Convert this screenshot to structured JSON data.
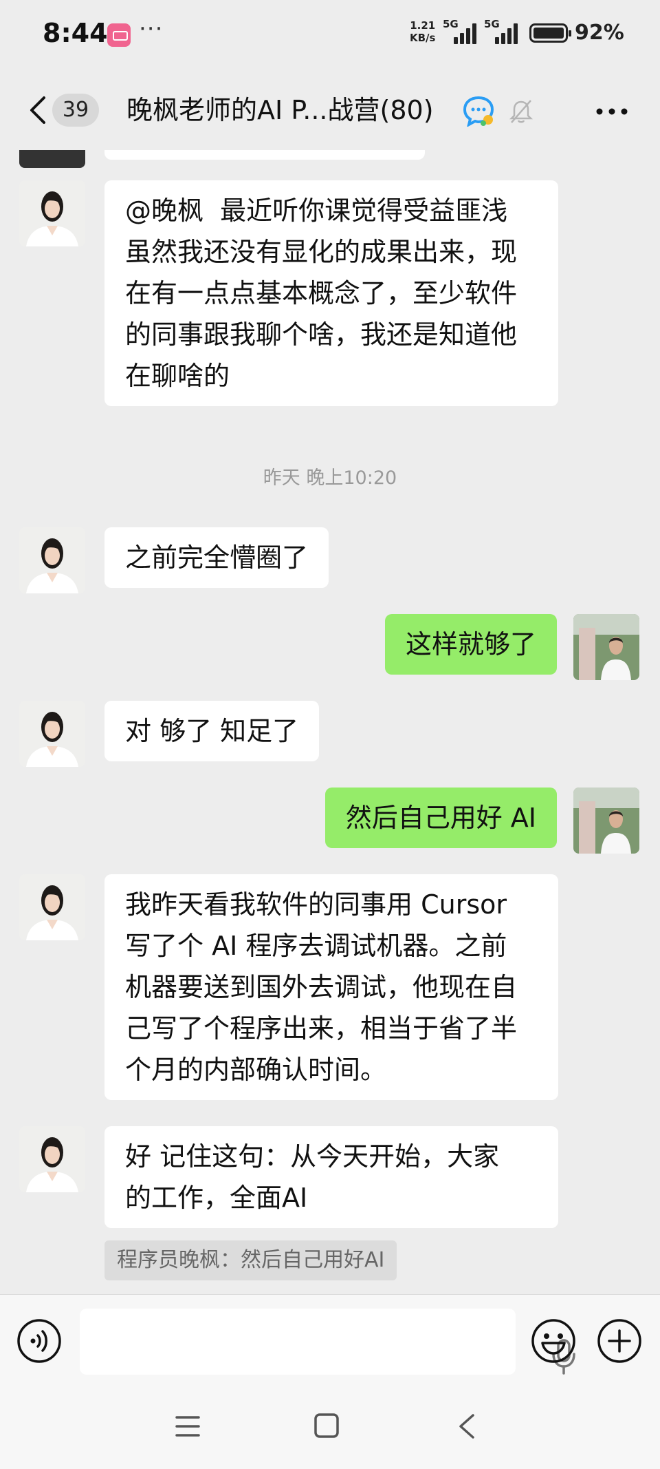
{
  "status_bar": {
    "time": "8:44",
    "more": "···",
    "speed_value": "1.21",
    "speed_unit": "KB/s",
    "net1": "5G",
    "net2": "5G",
    "battery": "92%"
  },
  "header": {
    "badge": "39",
    "title": "晚枫老师的AI P...战营(80)"
  },
  "messages": {
    "m0": "@晚枫  最近听你课觉得受益匪浅\n虽然我还没有显化的成果出来，现\n在有一点点基本概念了，至少软件\n的同事跟我聊个啥，我还是知道他\n在聊啥的",
    "timestamp": "昨天 晚上10:20",
    "m1": "之前完全懵圈了",
    "m2": "这样就够了",
    "m3": "对 够了 知足了",
    "m4": "然后自己用好 AI",
    "m5": "我昨天看我软件的同事用 Cursor\n写了个 AI 程序去调试机器。之前\n机器要送到国外去调试，他现在自\n己写了个程序出来，相当于省了半\n个月的内部确认时间。",
    "m6": "好 记住这句：从今天开始，大家\n的工作，全面AI",
    "quote": "程序员晚枫：然后自己用好AI"
  },
  "colors": {
    "background": "#ededed",
    "incoming_bubble": "#ffffff",
    "outgoing_bubble": "#95ec69",
    "quote_bg": "#dcdcdc"
  },
  "icons": {
    "back": "chevron-left-icon",
    "ai": "ai-assistant-icon",
    "mute": "bell-muted-icon",
    "menu": "more-dots-icon",
    "voice": "voice-icon",
    "mic": "microphone-icon",
    "emoji": "emoji-icon",
    "plus": "plus-icon"
  }
}
